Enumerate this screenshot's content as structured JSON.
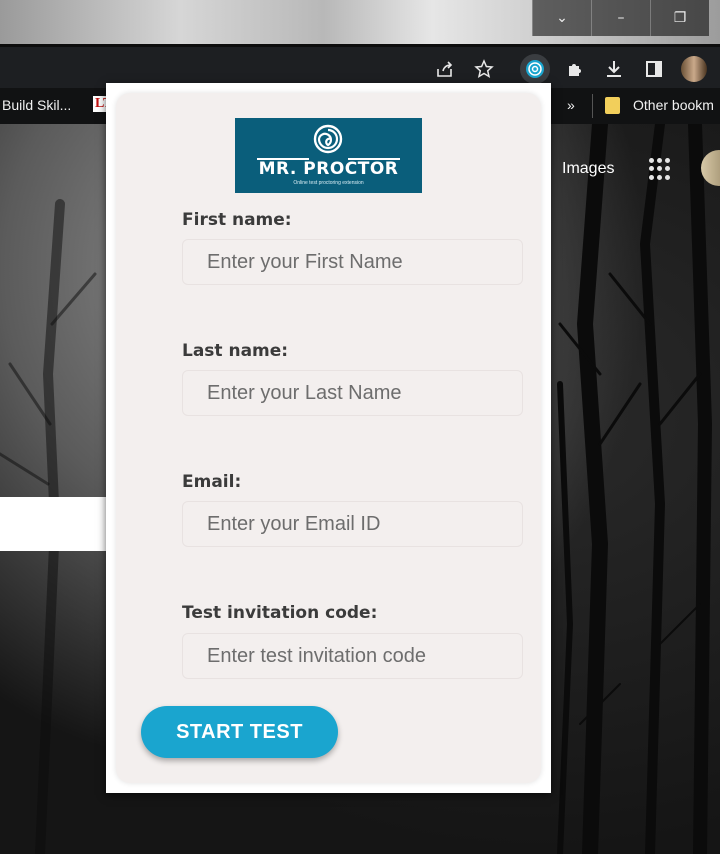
{
  "browser": {
    "window_controls": {
      "minimize_icon": "–",
      "restore_icon": "❐",
      "menu_icon": "⌄"
    },
    "bookmarks": {
      "item1": "Build Skil...",
      "item2": "LT",
      "overflow": "»",
      "other": "Other bookm"
    }
  },
  "page": {
    "images_link": "Images"
  },
  "extension": {
    "logo_title": "MR. PROCTOR",
    "logo_subtitle": "Online test proctoring extension",
    "fields": {
      "first_name": {
        "label": "First name:",
        "placeholder": "Enter your First Name"
      },
      "last_name": {
        "label": "Last name:",
        "placeholder": "Enter your Last Name"
      },
      "email": {
        "label": "Email:",
        "placeholder": "Enter your Email ID"
      },
      "code": {
        "label": "Test invitation code:",
        "placeholder": "Enter test invitation code"
      }
    },
    "start_button": "START TEST",
    "colors": {
      "accent": "#1aa5cf",
      "logo_bg": "#0a5e7b",
      "card_bg": "#f3efee"
    }
  }
}
